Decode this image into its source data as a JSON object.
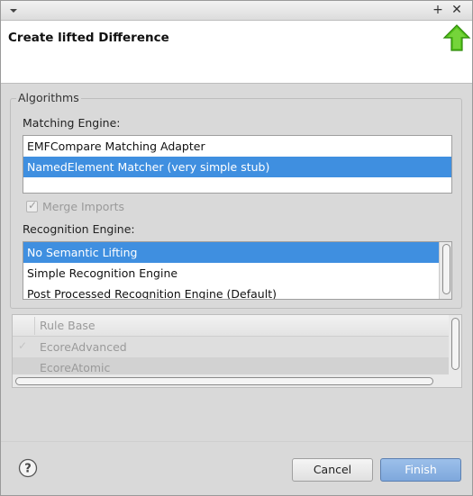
{
  "window": {
    "title": "Create lifted Difference",
    "titlebar_buttons": [
      "+",
      "✕"
    ]
  },
  "algorithms": {
    "group_label": "Algorithms",
    "matching_engine": {
      "label": "Matching Engine:",
      "items": [
        {
          "label": "EMFCompare Matching Adapter",
          "selected": false
        },
        {
          "label": "NamedElement Matcher (very simple stub)",
          "selected": true
        }
      ]
    },
    "merge_imports": {
      "label": "Merge Imports",
      "checked": true,
      "enabled": false
    },
    "recognition_engine": {
      "label": "Recognition Engine:",
      "items": [
        {
          "label": "No Semantic Lifting",
          "selected": true
        },
        {
          "label": "Simple Recognition Engine",
          "selected": false
        },
        {
          "label": "Post Processed Recognition Engine (Default)",
          "selected": false
        }
      ]
    }
  },
  "rule_table": {
    "header": "Rule Base",
    "rows": [
      {
        "label": "EcoreAdvanced",
        "checked": true
      },
      {
        "label": "EcoreAtomic",
        "checked": false
      }
    ]
  },
  "footer": {
    "help_icon": "question-mark-icon",
    "cancel_label": "Cancel",
    "finish_label": "Finish"
  },
  "colors": {
    "selection": "#3f8fe0",
    "arrow_icon": "#55c21c",
    "finish_button": "#8fb6e6"
  }
}
